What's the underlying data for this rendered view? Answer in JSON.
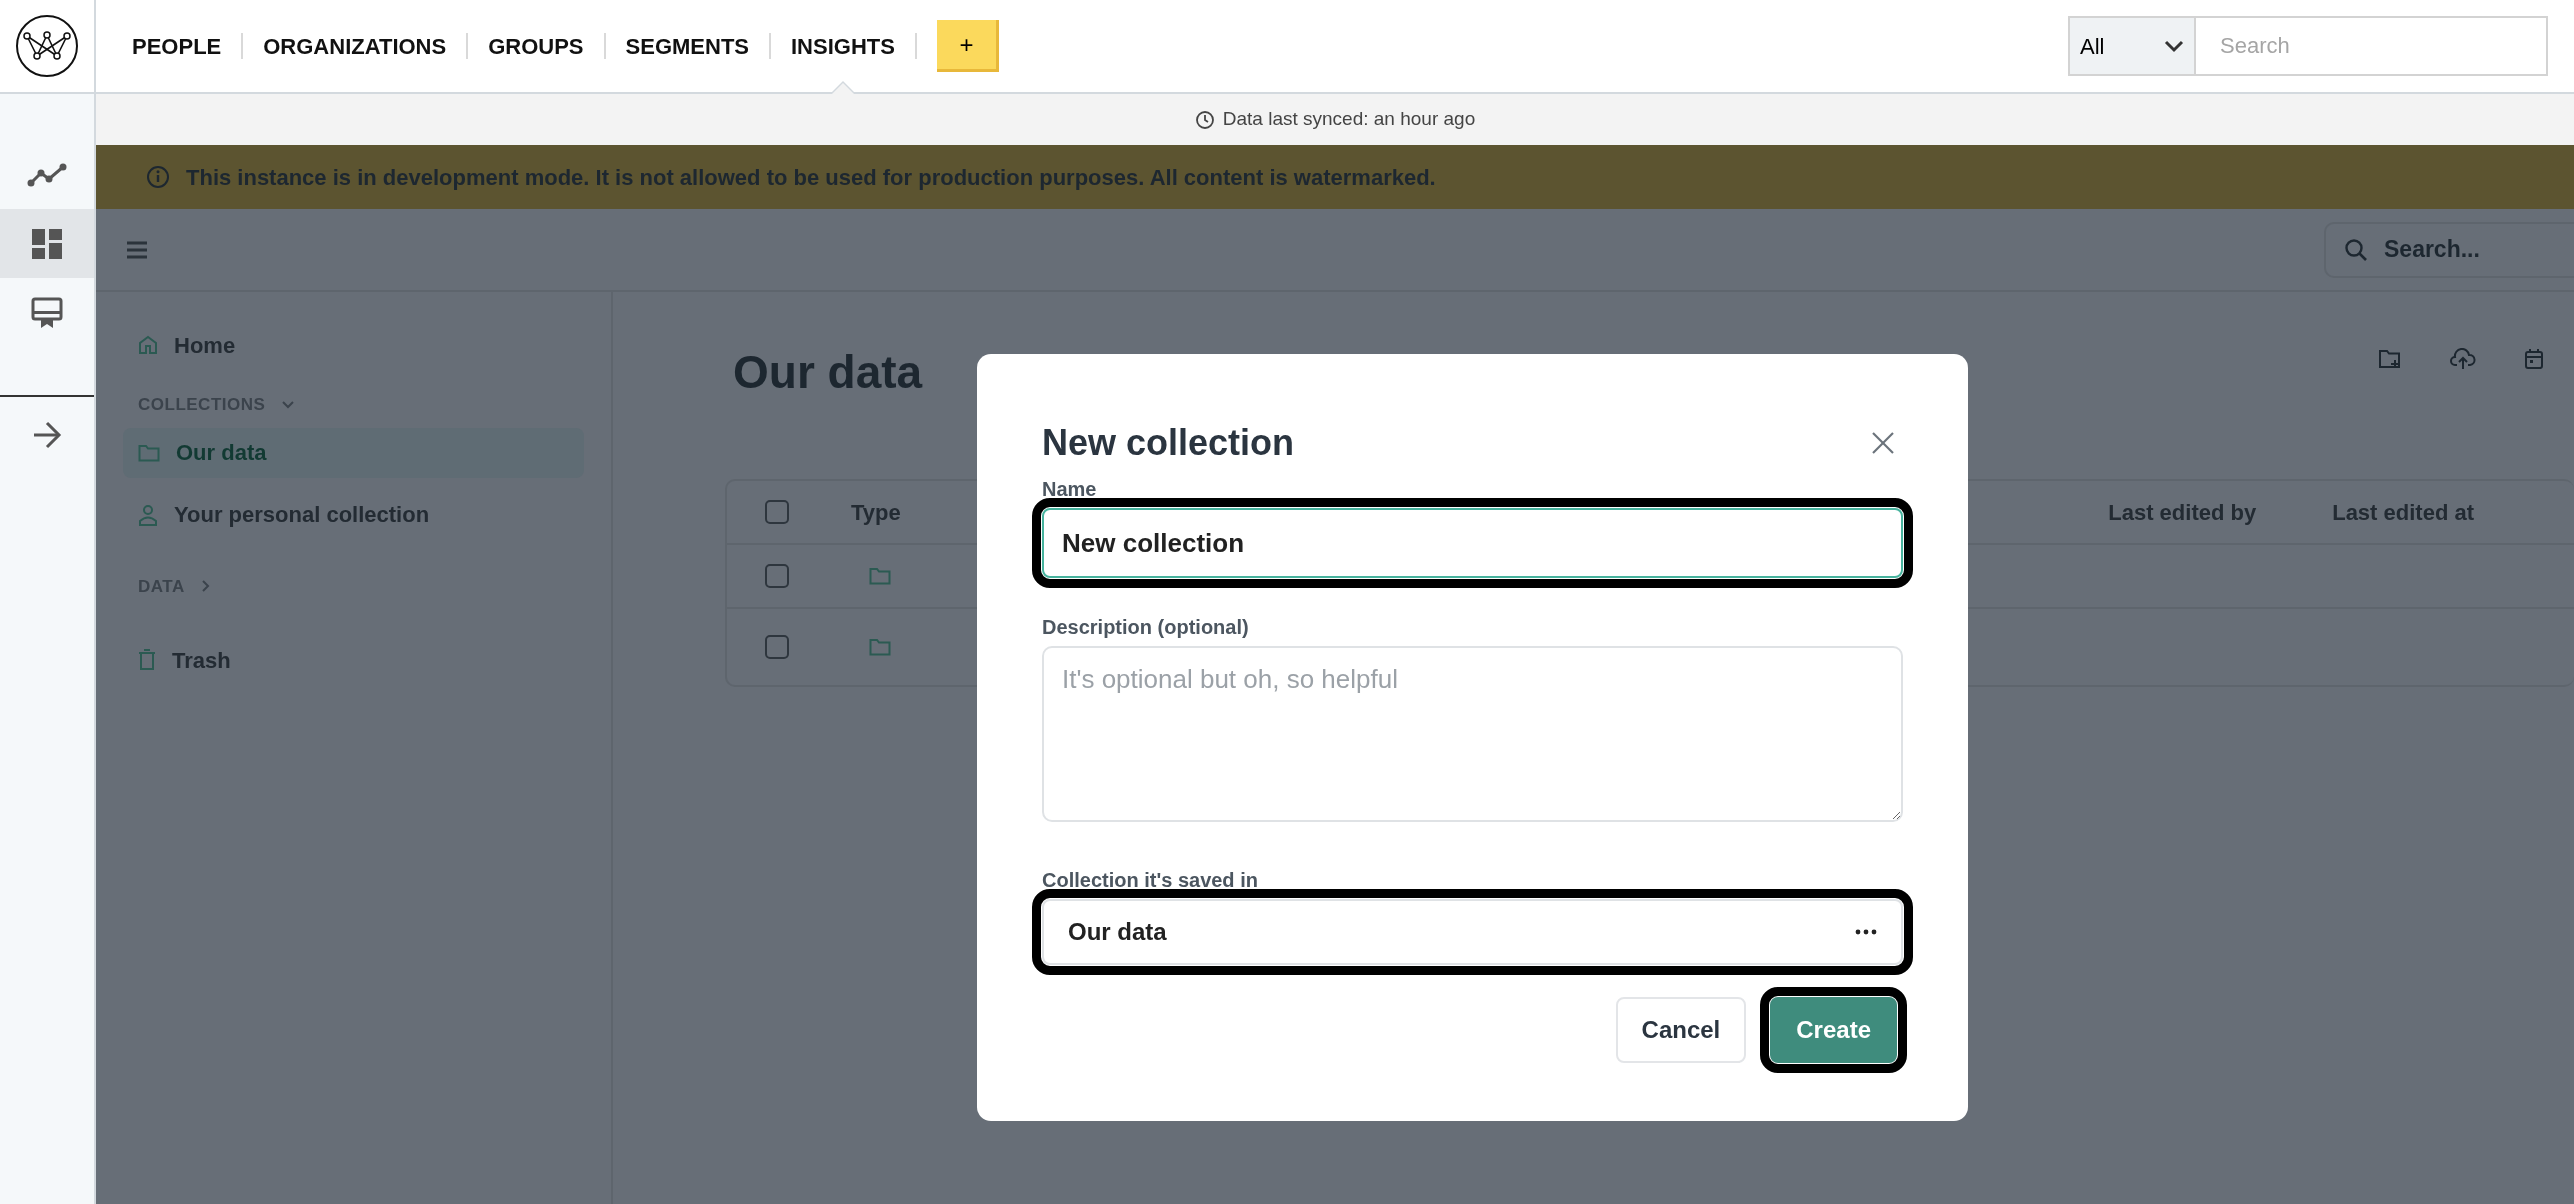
{
  "top_nav": {
    "items": [
      {
        "label": "PEOPLE",
        "selected": false
      },
      {
        "label": "ORGANIZATIONS",
        "selected": false
      },
      {
        "label": "GROUPS",
        "selected": false
      },
      {
        "label": "SEGMENTS",
        "selected": false
      },
      {
        "label": "INSIGHTS",
        "selected": true
      }
    ],
    "add_button": "+"
  },
  "global_search": {
    "scope": "All",
    "placeholder": "Search"
  },
  "rail": {
    "items": [
      {
        "kind": "chart",
        "selected": false
      },
      {
        "kind": "dashboard",
        "selected": true
      },
      {
        "kind": "display",
        "selected": false
      }
    ]
  },
  "sync_status": "Data last synced: an hour ago",
  "banner": "This instance is in development mode. It is not allowed to be used for production purposes. All content is watermarked.",
  "app_search": {
    "placeholder": "Search..."
  },
  "sidebar": {
    "home": "Home",
    "sections": [
      {
        "heading": "COLLECTIONS",
        "expanded": true,
        "items": [
          {
            "label": "Our data",
            "kind": "folder",
            "selected": true
          },
          {
            "label": "Your personal collection",
            "kind": "person",
            "selected": false
          }
        ]
      },
      {
        "heading": "DATA",
        "expanded": false
      }
    ],
    "trash": "Trash"
  },
  "page": {
    "title": "Our data",
    "table": {
      "header_checked": false,
      "columns": [
        "Type",
        "Last edited by",
        "Last edited at"
      ],
      "rows": [
        {
          "checked": false,
          "kind": "folder"
        },
        {
          "checked": false,
          "kind": "folder"
        }
      ]
    }
  },
  "modal": {
    "title": "New collection",
    "name": {
      "label": "Name",
      "value": "New collection",
      "highlighted": true
    },
    "description": {
      "label": "Description (optional)",
      "placeholder": "It's optional but oh, so helpful"
    },
    "parent": {
      "label": "Collection it's saved in",
      "value": "Our data",
      "highlighted": true
    },
    "buttons": [
      {
        "label": "Cancel",
        "kind": "secondary",
        "highlighted": false
      },
      {
        "label": "Create",
        "kind": "primary",
        "highlighted": true
      }
    ]
  }
}
